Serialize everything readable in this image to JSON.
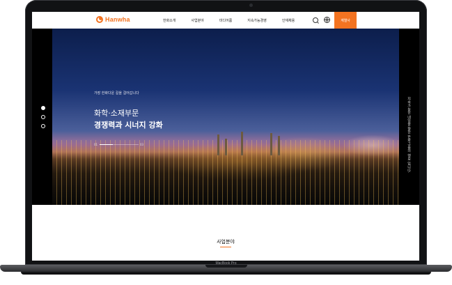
{
  "device": {
    "label": "MacBook Pro"
  },
  "header": {
    "logo_text": "Hanwha",
    "nav": [
      "한화소개",
      "사업분야",
      "미디어룸",
      "지속가능경영",
      "인재채용"
    ],
    "cta_label": "계열사",
    "icons": [
      "search-icon",
      "globe-icon"
    ]
  },
  "hero": {
    "subtitle": "가장 한화다운 길을 걸어갑니다",
    "title_line1": "화학·소재부문",
    "title_line2": "경쟁력과 시너지 강화",
    "pager": {
      "start": "01",
      "end": "03",
      "current": 1,
      "total": 3
    },
    "side_text": "지속가능한 내일을 향한 한화그룹의 행보 입니다."
  },
  "section": {
    "title": "사업분야"
  },
  "colors": {
    "accent": "#f37321",
    "dark": "#111214"
  }
}
